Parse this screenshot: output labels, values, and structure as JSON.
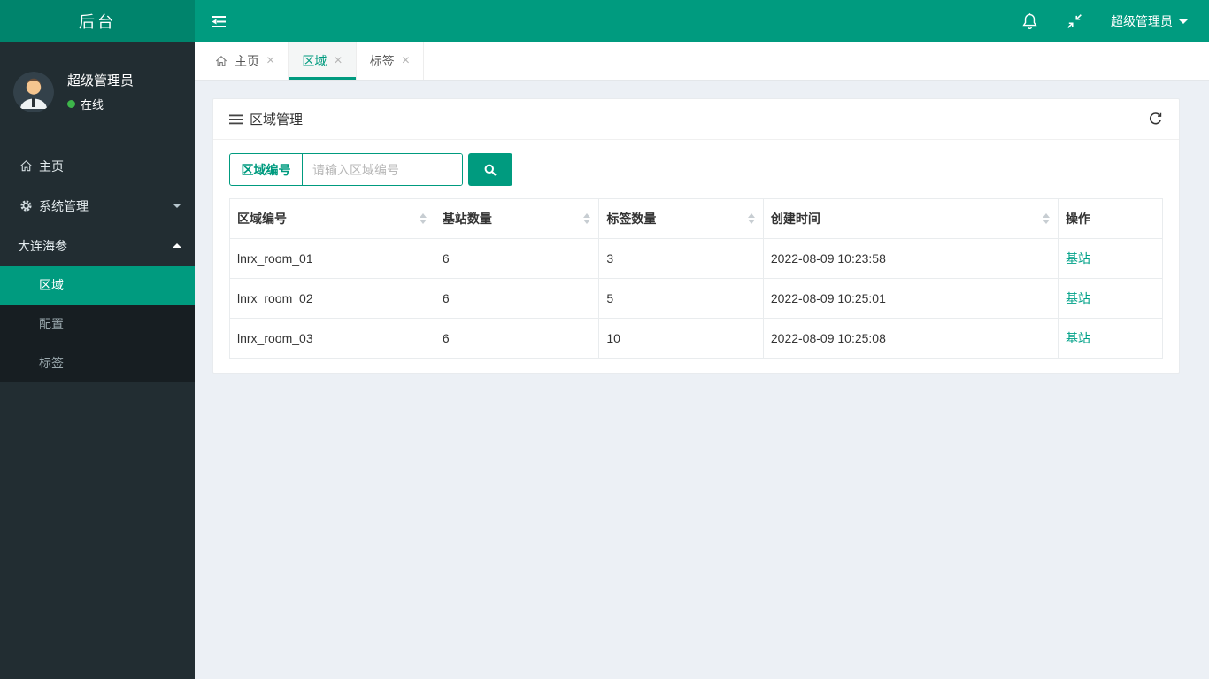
{
  "header": {
    "logo": "后台",
    "user": "超级管理员"
  },
  "sidebar": {
    "user": {
      "name": "超级管理员",
      "status": "在线"
    },
    "menu": [
      {
        "label": "主页",
        "icon": "home"
      },
      {
        "label": "系统管理",
        "icon": "gear"
      },
      {
        "label": "大连海参",
        "icon": "none"
      }
    ],
    "submenu": [
      {
        "label": "区域",
        "active": true
      },
      {
        "label": "配置",
        "active": false
      },
      {
        "label": "标签",
        "active": false
      }
    ]
  },
  "tabs": [
    {
      "label": "主页",
      "active": false
    },
    {
      "label": "区域",
      "active": true
    },
    {
      "label": "标签",
      "active": false
    }
  ],
  "panel": {
    "title": "区域管理",
    "search": {
      "label": "区域编号",
      "placeholder": "请输入区域编号"
    },
    "table": {
      "columns": [
        {
          "label": "区域编号",
          "sortable": true
        },
        {
          "label": "基站数量",
          "sortable": true
        },
        {
          "label": "标签数量",
          "sortable": true
        },
        {
          "label": "创建时间",
          "sortable": true
        },
        {
          "label": "操作",
          "sortable": false
        }
      ],
      "rows": [
        {
          "region": "lnrx_room_01",
          "stations": "6",
          "tags": "3",
          "created": "2022-08-09 10:23:58",
          "action": "基站"
        },
        {
          "region": "lnrx_room_02",
          "stations": "6",
          "tags": "5",
          "created": "2022-08-09 10:25:01",
          "action": "基站"
        },
        {
          "region": "lnrx_room_03",
          "stations": "6",
          "tags": "10",
          "created": "2022-08-09 10:25:08",
          "action": "基站"
        }
      ]
    }
  },
  "colors": {
    "accent": "#009b7f",
    "logo_bg": "#00846c",
    "sidebar_bg": "#222d32",
    "submenu_bg": "#171e22",
    "content_bg": "#ecf0f5",
    "link": "#00a188",
    "online_dot": "#3db54a"
  }
}
